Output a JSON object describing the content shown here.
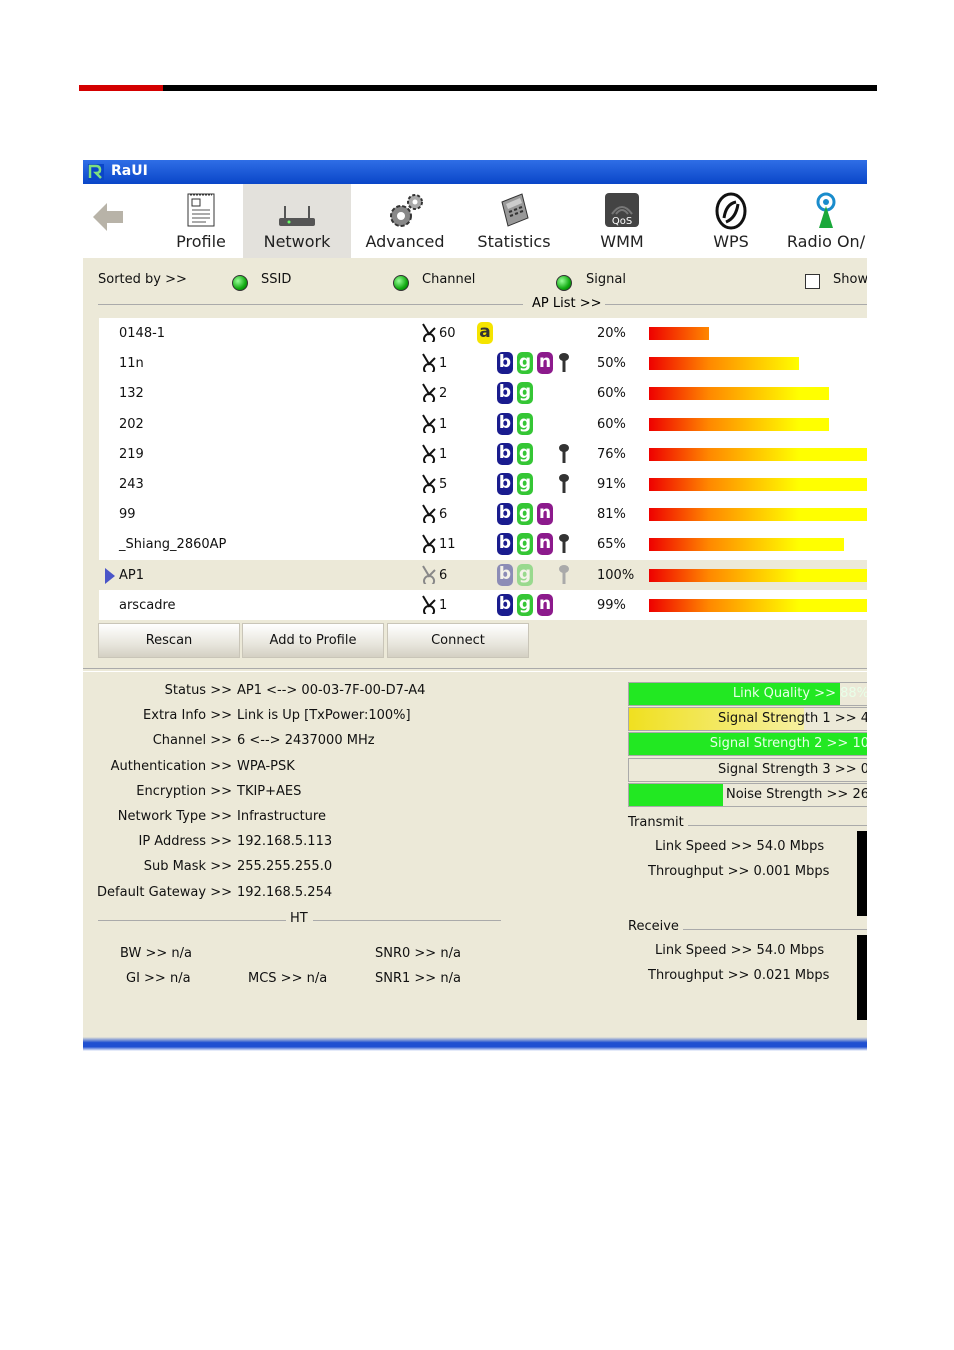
{
  "window": {
    "title": "RaUI"
  },
  "toolbar": {
    "items": [
      {
        "label": "Profile",
        "icon": "profile-icon"
      },
      {
        "label": "Network",
        "icon": "network-icon",
        "selected": true
      },
      {
        "label": "Advanced",
        "icon": "gear-icon"
      },
      {
        "label": "Statistics",
        "icon": "calculator-icon"
      },
      {
        "label": "WMM",
        "icon": "qos-icon"
      },
      {
        "label": "WPS",
        "icon": "wps-icon"
      },
      {
        "label": "Radio On/",
        "icon": "radio-icon"
      }
    ]
  },
  "sort": {
    "label": "Sorted by >>",
    "ssid": "SSID",
    "channel": "Channel",
    "signal": "Signal",
    "show": "Show"
  },
  "ap_list": {
    "label": "AP List >>",
    "rows": [
      {
        "ssid": "0148-1",
        "channel": "60",
        "bands": [
          "a"
        ],
        "key": false,
        "signal": "20%",
        "level": 0.2
      },
      {
        "ssid": "11n",
        "channel": "1",
        "bands": [
          "b",
          "g",
          "n"
        ],
        "key": true,
        "signal": "50%",
        "level": 0.5
      },
      {
        "ssid": "132",
        "channel": "2",
        "bands": [
          "b",
          "g"
        ],
        "key": false,
        "signal": "60%",
        "level": 0.6
      },
      {
        "ssid": "202",
        "channel": "1",
        "bands": [
          "b",
          "g"
        ],
        "key": false,
        "signal": "60%",
        "level": 0.6
      },
      {
        "ssid": "219",
        "channel": "1",
        "bands": [
          "b",
          "g"
        ],
        "key": true,
        "signal": "76%",
        "level": 0.76
      },
      {
        "ssid": "243",
        "channel": "5",
        "bands": [
          "b",
          "g"
        ],
        "key": true,
        "signal": "91%",
        "level": 0.91
      },
      {
        "ssid": "99",
        "channel": "6",
        "bands": [
          "b",
          "g",
          "n"
        ],
        "key": false,
        "signal": "81%",
        "level": 0.81
      },
      {
        "ssid": "_Shiang_2860AP",
        "channel": "11",
        "bands": [
          "b",
          "g",
          "n"
        ],
        "key": true,
        "signal": "65%",
        "level": 0.65
      },
      {
        "ssid": "AP1",
        "channel": "6",
        "bands": [
          "b",
          "g"
        ],
        "key": true,
        "signal": "100%",
        "level": 1.0,
        "selected": true
      },
      {
        "ssid": "arscadre",
        "channel": "1",
        "bands": [
          "b",
          "g",
          "n"
        ],
        "key": false,
        "signal": "99%",
        "level": 0.99
      }
    ]
  },
  "buttons": {
    "rescan": "Rescan",
    "add": "Add to Profile",
    "connect": "Connect"
  },
  "info": [
    {
      "k": "Status >>",
      "v": "AP1 <--> 00-03-7F-00-D7-A4"
    },
    {
      "k": "Extra Info >>",
      "v": "Link is Up [TxPower:100%]"
    },
    {
      "k": "Channel >>",
      "v": "6 <--> 2437000 MHz"
    },
    {
      "k": "Authentication >>",
      "v": "WPA-PSK"
    },
    {
      "k": "Encryption >>",
      "v": "TKIP+AES"
    },
    {
      "k": "Network Type >>",
      "v": "Infrastructure"
    },
    {
      "k": "IP Address >>",
      "v": "192.168.5.113"
    },
    {
      "k": "Sub Mask >>",
      "v": "255.255.255.0"
    },
    {
      "k": "Default Gateway >>",
      "v": "192.168.5.254"
    }
  ],
  "ht": {
    "label": "HT",
    "bw": "BW >> n/a",
    "gi": "GI >> n/a",
    "mcs": "MCS >> n/a",
    "snr0": "SNR0 >> n/a",
    "snr1": "SNR1 >> n/a"
  },
  "quality": [
    {
      "label": "Link Quality >> 88%",
      "level": 0.88,
      "color": "#22e822"
    },
    {
      "label": "Signal Strength 1 >> 4",
      "level": 0.73,
      "color": "#f0e020"
    },
    {
      "label": "Signal Strength 2 >> 10",
      "level": 1.0,
      "color": "#22e822"
    },
    {
      "label": "Signal Strength 3 >> 0",
      "level": 0.0,
      "color": "#22e822"
    },
    {
      "label": "Noise Strength >> 26",
      "level": 0.39,
      "color": "#22e822"
    }
  ],
  "transmit": {
    "title": "Transmit",
    "link_speed": "Link Speed >> 54.0 Mbps",
    "throughput": "Throughput >> 0.001 Mbps"
  },
  "receive": {
    "title": "Receive",
    "link_speed": "Link Speed >> 54.0 Mbps",
    "throughput": "Throughput >> 0.021 Mbps"
  }
}
